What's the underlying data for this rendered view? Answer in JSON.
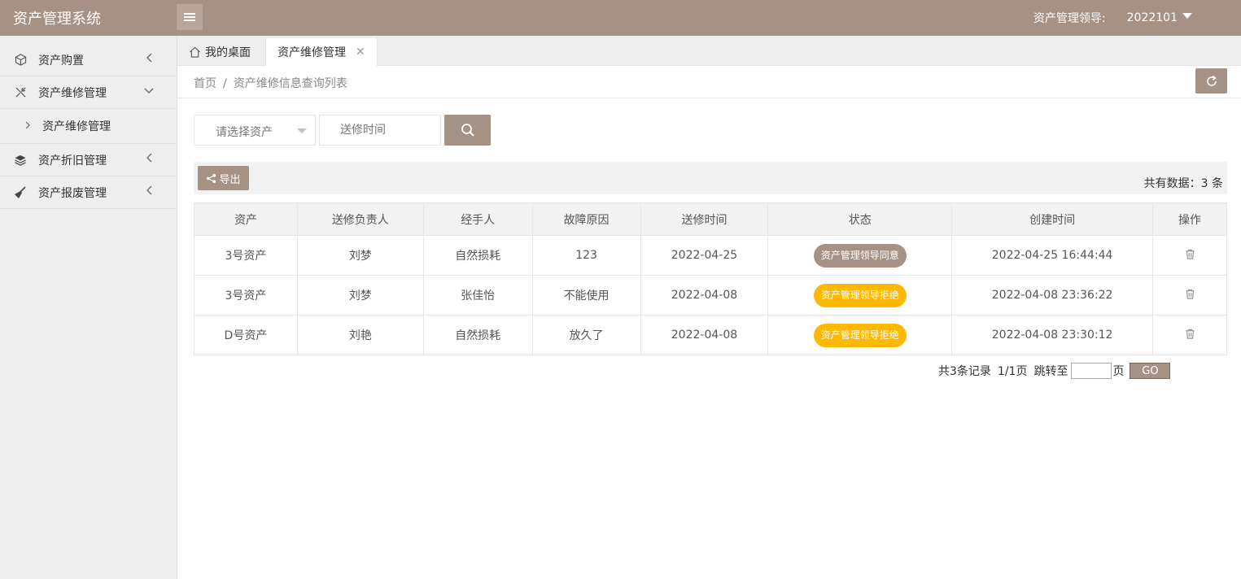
{
  "header": {
    "title": "资产管理系统",
    "role_label": "资产管理领导:",
    "username": "2022101"
  },
  "sidebar": {
    "items": [
      {
        "label": "资产购置",
        "icon": "cube-icon",
        "arrow": "<"
      },
      {
        "label": "资产维修管理",
        "icon": "tools-icon",
        "arrow": "v"
      },
      {
        "label": "资产折旧管理",
        "icon": "layers-icon",
        "arrow": "<"
      },
      {
        "label": "资产报废管理",
        "icon": "broom-icon",
        "arrow": "<"
      }
    ],
    "sub_item": {
      "label": "资产维修管理"
    }
  },
  "tabs": {
    "home": "我的桌面",
    "active": "资产维修管理",
    "close": "✕"
  },
  "breadcrumb": {
    "home": "首页",
    "sep": "/",
    "current": "资产维修信息查询列表"
  },
  "search": {
    "asset_placeholder": "请选择资产",
    "date_placeholder": "送修时间"
  },
  "toolbar": {
    "export_label": "导出",
    "total_text": "共有数据：3 条"
  },
  "table": {
    "headers": [
      "资产",
      "送修负责人",
      "经手人",
      "故障原因",
      "送修时间",
      "状态",
      "创建时间",
      "操作"
    ],
    "rows": [
      {
        "asset": "3号资产",
        "owner": "刘梦",
        "handler": "自然损耗",
        "reason": "123",
        "repair_date": "2022-04-25",
        "status": "资产管理领导同意",
        "status_color": "#a69185",
        "created": "2022-04-25 16:44:44"
      },
      {
        "asset": "3号资产",
        "owner": "刘梦",
        "handler": "张佳怡",
        "reason": "不能使用",
        "repair_date": "2022-04-08",
        "status": "资产管理领导拒绝",
        "status_color": "#ffb800",
        "created": "2022-04-08 23:36:22"
      },
      {
        "asset": "D号资产",
        "owner": "刘艳",
        "handler": "自然损耗",
        "reason": "放久了",
        "repair_date": "2022-04-08",
        "status": "资产管理领导拒绝",
        "status_color": "#ffb800",
        "created": "2022-04-08 23:30:12"
      }
    ]
  },
  "pager": {
    "summary": "共3条记录",
    "pages": "1/1页",
    "jump_label": "跳转至",
    "page_unit": "页",
    "go_label": "GO"
  },
  "colors": {
    "primary": "#a69185",
    "warning": "#ffb800"
  }
}
